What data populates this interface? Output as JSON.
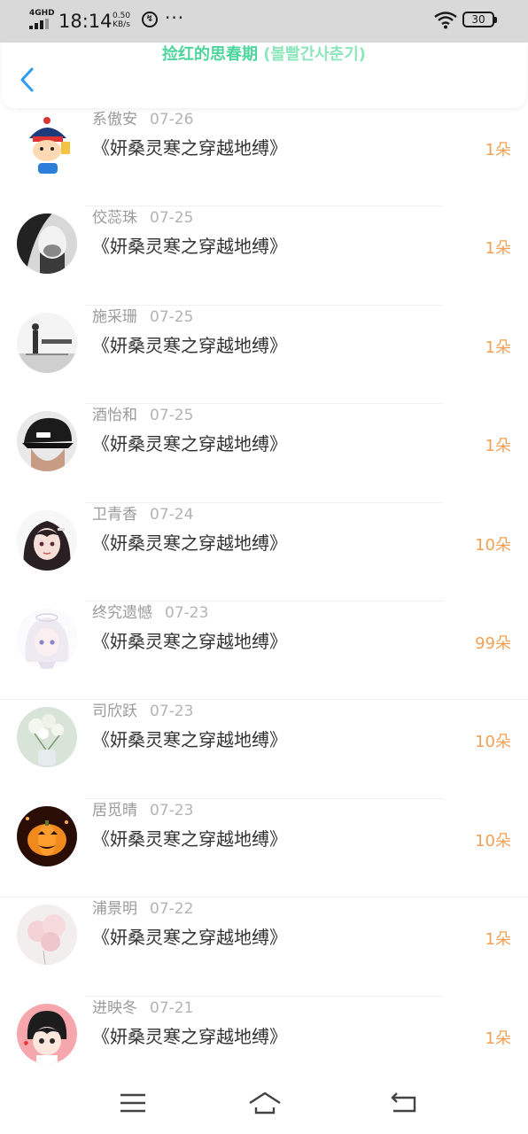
{
  "status_bar": {
    "network": "4GHD",
    "time": "18:14",
    "speed_value": "0.50",
    "speed_unit": "KB/s",
    "usb_icon": "usb-debug-icon",
    "more": "···",
    "battery": "30"
  },
  "header": {
    "title": "捡红的思春期",
    "subtitle": " (볼빨간사춘기)",
    "back_icon": "chevron-left-icon",
    "accent_color": "#4cd69b"
  },
  "list": [
    {
      "name": "系傲安",
      "date": "07-26",
      "book": "《妍桑灵寒之穿越地缚》",
      "count": "1朵",
      "avatar": "cartoon-hat"
    },
    {
      "name": "佼蕊珠",
      "date": "07-25",
      "book": "《妍桑灵寒之穿越地缚》",
      "count": "1朵",
      "avatar": "bw-face"
    },
    {
      "name": "施采珊",
      "date": "07-25",
      "book": "《妍桑灵寒之穿越地缚》",
      "count": "1朵",
      "avatar": "bw-text"
    },
    {
      "name": "酒怡和",
      "date": "07-25",
      "book": "《妍桑灵寒之穿越地缚》",
      "count": "1朵",
      "avatar": "black-cap"
    },
    {
      "name": "卫青香",
      "date": "07-24",
      "book": "《妍桑灵寒之穿越地缚》",
      "count": "10朵",
      "avatar": "anime-girl"
    },
    {
      "name": "终究遗憾",
      "date": "07-23",
      "book": "《妍桑灵寒之穿越地缚》",
      "count": "99朵",
      "avatar": "white-hair"
    },
    {
      "name": "司欣跃",
      "date": "07-23",
      "book": "《妍桑灵寒之穿越地缚》",
      "count": "10朵",
      "avatar": "flowers"
    },
    {
      "name": "居觅晴",
      "date": "07-23",
      "book": "《妍桑灵寒之穿越地缚》",
      "count": "10朵",
      "avatar": "pumpkin"
    },
    {
      "name": "浦景明",
      "date": "07-22",
      "book": "《妍桑灵寒之穿越地缚》",
      "count": "1朵",
      "avatar": "balloons"
    },
    {
      "name": "进映冬",
      "date": "07-21",
      "book": "《妍桑灵寒之穿越地缚》",
      "count": "1朵",
      "avatar": "chibi-boy"
    }
  ],
  "colors": {
    "count": "#f0a155",
    "name": "#9a9a9a",
    "book": "#333333",
    "status_bar_bg": "#d9d9d9"
  },
  "navbar": {
    "menu_icon": "menu-icon",
    "home_icon": "home-icon",
    "back_icon": "back-arrow-icon"
  }
}
